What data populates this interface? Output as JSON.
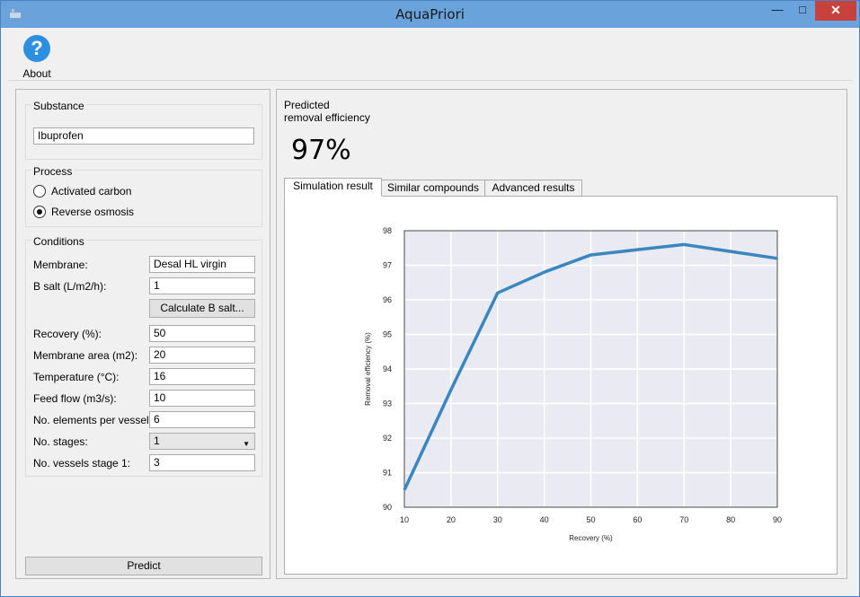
{
  "window": {
    "title": "AquaPriori"
  },
  "toolbar": {
    "about_label": "About"
  },
  "substance": {
    "group_title": "Substance",
    "value": "Ibuprofen"
  },
  "process": {
    "group_title": "Process",
    "options": [
      {
        "label": "Activated carbon",
        "checked": false
      },
      {
        "label": "Reverse osmosis",
        "checked": true
      }
    ]
  },
  "conditions": {
    "group_title": "Conditions",
    "membrane_label": "Membrane:",
    "membrane_value": "Desal HL virgin",
    "bsalt_label": "B salt (L/m2/h):",
    "bsalt_value": "1",
    "calc_button": "Calculate B salt...",
    "recovery_label": "Recovery (%):",
    "recovery_value": "50",
    "area_label": "Membrane area (m2):",
    "area_value": "20",
    "temp_label": "Temperature (°C):",
    "temp_value": "16",
    "feed_label": "Feed flow (m3/s):",
    "feed_value": "10",
    "elements_label": "No. elements per vessel:",
    "elements_value": "6",
    "stages_label": "No. stages:",
    "stages_value": "1",
    "vessels_label": "No. vessels stage 1:",
    "vessels_value": "3"
  },
  "predict_button": "Predict",
  "prediction": {
    "label_line1": "Predicted",
    "label_line2": "removal efficiency",
    "value": "97%"
  },
  "tabs": [
    {
      "label": "Simulation result",
      "active": true
    },
    {
      "label": "Similar compounds",
      "active": false
    },
    {
      "label": "Advanced results",
      "active": false
    }
  ],
  "chart_data": {
    "type": "line",
    "x": [
      10,
      20,
      30,
      40,
      50,
      60,
      70,
      80,
      90
    ],
    "series": [
      {
        "values": [
          90.5,
          93.4,
          96.2,
          96.8,
          97.3,
          97.45,
          97.6,
          97.4,
          97.2
        ]
      }
    ],
    "xlabel": "Recovery (%)",
    "ylabel": "Removal efficiency (%)",
    "xlim": [
      10,
      90
    ],
    "ylim": [
      90,
      98
    ],
    "xticks": [
      "10",
      "20",
      "30",
      "40",
      "50",
      "60",
      "70",
      "80",
      "90"
    ],
    "yticks": [
      "90",
      "91",
      "92",
      "93",
      "94",
      "95",
      "96",
      "97",
      "98"
    ],
    "grid": true,
    "line_color": "#3a87c0",
    "plot_bg": "#eaeaf2"
  }
}
